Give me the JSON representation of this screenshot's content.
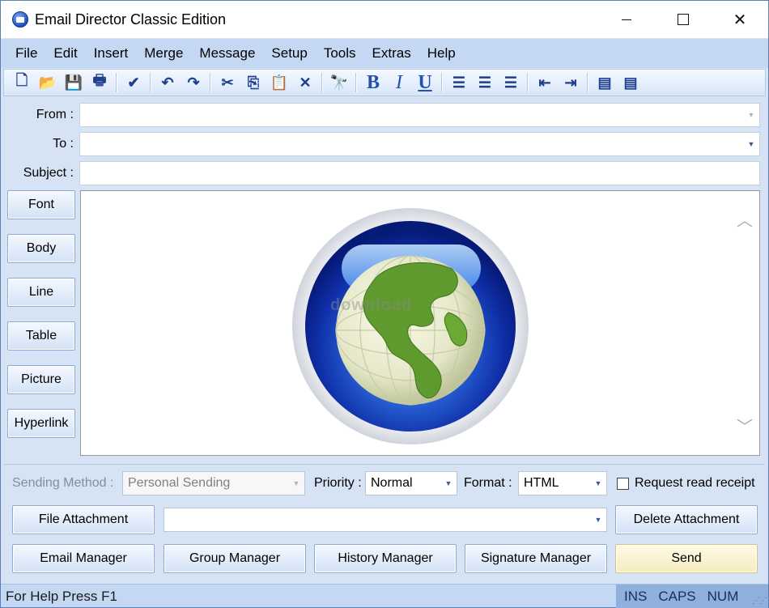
{
  "window": {
    "title": "Email Director Classic Edition",
    "controls": {
      "minimize": "–",
      "maximize": "□",
      "close": "✕"
    }
  },
  "menu": [
    "File",
    "Edit",
    "Insert",
    "Merge",
    "Message",
    "Setup",
    "Tools",
    "Extras",
    "Help"
  ],
  "toolbar": [
    {
      "name": "new-icon",
      "glyph": "🗋"
    },
    {
      "name": "open-icon",
      "glyph": "📂"
    },
    {
      "name": "save-icon",
      "glyph": "💾"
    },
    {
      "name": "print-icon",
      "glyph": "🖶"
    },
    {
      "name": "sep"
    },
    {
      "name": "spellcheck-icon",
      "glyph": "✔"
    },
    {
      "name": "sep"
    },
    {
      "name": "undo-icon",
      "glyph": "↶"
    },
    {
      "name": "redo-icon",
      "glyph": "↷"
    },
    {
      "name": "sep"
    },
    {
      "name": "cut-icon",
      "glyph": "✂"
    },
    {
      "name": "copy-icon",
      "glyph": "⎘"
    },
    {
      "name": "paste-icon",
      "glyph": "📋"
    },
    {
      "name": "delete-icon",
      "glyph": "✕"
    },
    {
      "name": "sep"
    },
    {
      "name": "find-icon",
      "glyph": "🔭"
    },
    {
      "name": "sep"
    },
    {
      "name": "bold-icon",
      "glyph": "B",
      "cls": "bold"
    },
    {
      "name": "italic-icon",
      "glyph": "I",
      "cls": "italic"
    },
    {
      "name": "underline-icon",
      "glyph": "U",
      "cls": "underline"
    },
    {
      "name": "sep"
    },
    {
      "name": "align-left-icon",
      "glyph": "☰"
    },
    {
      "name": "align-center-icon",
      "glyph": "☰"
    },
    {
      "name": "align-right-icon",
      "glyph": "☰"
    },
    {
      "name": "sep"
    },
    {
      "name": "outdent-icon",
      "glyph": "⇤"
    },
    {
      "name": "indent-icon",
      "glyph": "⇥"
    },
    {
      "name": "sep"
    },
    {
      "name": "numbered-list-icon",
      "glyph": "▤"
    },
    {
      "name": "bullet-list-icon",
      "glyph": "▤"
    }
  ],
  "fields": {
    "from_label": "From :",
    "from_value": "",
    "to_label": "To :",
    "to_value": "",
    "subject_label": "Subject :",
    "subject_value": ""
  },
  "side_buttons": [
    "Font",
    "Body",
    "Line",
    "Table",
    "Picture",
    "Hyperlink"
  ],
  "watermark": "download",
  "options": {
    "sending_method_label": "Sending Method :",
    "sending_method_value": "Personal Sending",
    "priority_label": "Priority :",
    "priority_value": "Normal",
    "format_label": "Format :",
    "format_value": "HTML",
    "read_receipt_label": "Request read receipt",
    "read_receipt_checked": false
  },
  "attachment": {
    "button": "File Attachment",
    "value": "",
    "delete_button": "Delete Attachment"
  },
  "actions": [
    "Email Manager",
    "Group Manager",
    "History Manager",
    "Signature Manager",
    "Send"
  ],
  "status": {
    "help": "For Help Press F1",
    "ins": "INS",
    "caps": "CAPS",
    "num": "NUM"
  },
  "colors": {
    "accent": "#c4d8f3",
    "status_panel": "#8fb0dc",
    "send_button": "#f6ebc0"
  }
}
